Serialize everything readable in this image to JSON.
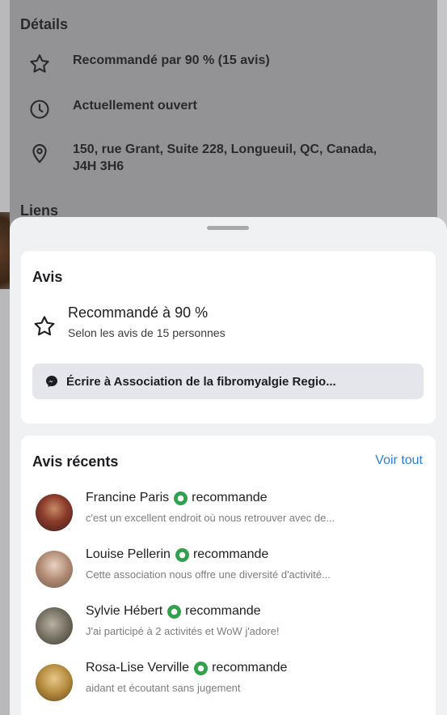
{
  "background": {
    "section_title": "Détails",
    "rows": [
      {
        "icon": "star-outline-icon",
        "text": "Recommandé par 90 % (15 avis)"
      },
      {
        "icon": "clock-icon",
        "text": "Actuellement ouvert"
      },
      {
        "icon": "location-pin-icon",
        "text": "150, rue Grant, Suite 228, Longueuil, QC, Canada, J4H 3H6"
      }
    ],
    "links_title": "Liens"
  },
  "sheet": {
    "reviews_card": {
      "title": "Avis",
      "recommend_title": "Recommandé à 90 %",
      "recommend_subtitle": "Selon les avis de 15 personnes",
      "message_button_label": "Écrire à Association de la fibromyalgie Regio..."
    },
    "recent": {
      "title": "Avis récents",
      "see_all": "Voir tout",
      "items": [
        {
          "name": "Francine Paris",
          "verb": "recommande",
          "text": "c'est un excellent endroit où nous retrouver avec de..."
        },
        {
          "name": "Louise Pellerin",
          "verb": "recommande",
          "text": "Cette association nous offre une diversité d'activité..."
        },
        {
          "name": "Sylvie Hébert",
          "verb": "recommande",
          "text": "J'ai participé à 2 activités et WoW j'adore!"
        },
        {
          "name": "Rosa-Lise Verville",
          "verb": "recommande",
          "text": "aidant et écoutant sans jugement"
        }
      ]
    }
  },
  "colors": {
    "accent_link": "#2d7fd6",
    "recommend_green": "#31a24c",
    "overlay": "#8e8e90"
  }
}
